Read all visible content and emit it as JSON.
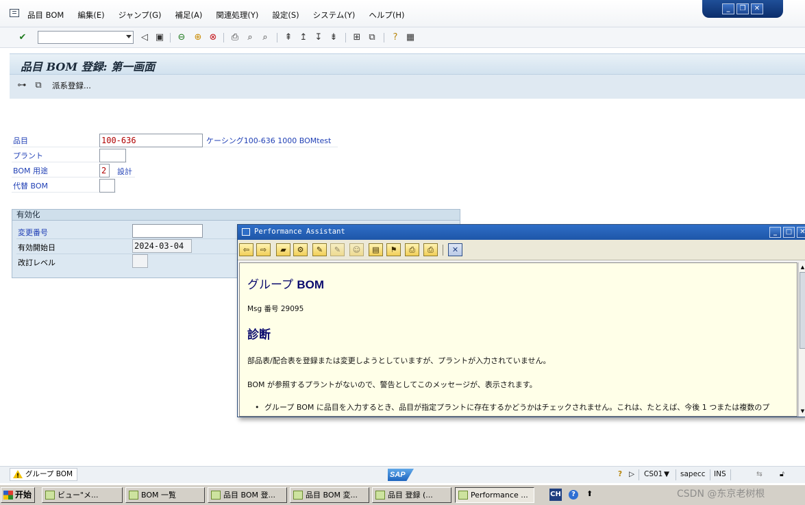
{
  "menubar": {
    "items": [
      "品目 BOM",
      "編集(E)",
      "ジャンプ(G)",
      "補足(A)",
      "関連処理(Y)",
      "設定(S)",
      "システム(Y)",
      "ヘルプ(H)"
    ]
  },
  "toolbar": {
    "command_field_value": "",
    "icons": [
      "enter-icon",
      "back-icon",
      "save-icon",
      "green-back-icon",
      "exit-icon",
      "cancel-icon",
      "print-icon",
      "find-icon",
      "find-next-icon",
      "first-page-icon",
      "prev-page-icon",
      "next-page-icon",
      "last-page-icon",
      "new-session-icon",
      "shortcut-icon",
      "help-icon",
      "layout-icon"
    ]
  },
  "title": {
    "text": "品目 BOM 登録: 第一画面",
    "app_toolbar_label": "派系登録..."
  },
  "form": {
    "material_label": "品目",
    "material_value": "100-636",
    "material_desc": "ケーシング100-636 1000 BOMtest",
    "plant_label": "プラント",
    "plant_value": "",
    "usage_label": "BOM 用途",
    "usage_value": "2",
    "usage_desc": "設計",
    "alt_label": "代替 BOM",
    "alt_value": ""
  },
  "validity": {
    "title": "有効化",
    "change_no_label": "変更番号",
    "change_no_value": "",
    "valid_from_label": "有効開始日",
    "valid_from_value": "2024-03-04",
    "revision_label": "改訂レベル",
    "revision_value": ""
  },
  "assistant": {
    "window_title": "Performance Assistant",
    "heading_prefix": "グループ ",
    "heading_bold": "BOM",
    "msg_no": "Msg 番号 29095",
    "section": "診断",
    "para1": "部品表/配合表を登録または変更しようとしていますが、プラントが入力されていません。",
    "para2": "BOM が参照するプラントがないので、警告としてこのメッセージが、表示されます。",
    "bullet1": "グループ BOM に品目を入力するとき、品目が指定プラントに存在するかどうかはチェックされません。これは、たとえば、今後 1 つまたは複数のプ"
  },
  "statusbar": {
    "message": "グループ BOM",
    "transaction": "CS01",
    "server": "sapecc",
    "mode": "INS",
    "logo_text": "SAP"
  },
  "taskbar": {
    "start": "开始",
    "tasks": [
      "ビュー\"メ...",
      "BOM 一覧",
      "品目 BOM 登...",
      "品目 BOM 変...",
      "品目 登録 (...",
      "Performance ..."
    ],
    "ime": "CH",
    "watermark": "CSDN @东京老树根"
  }
}
